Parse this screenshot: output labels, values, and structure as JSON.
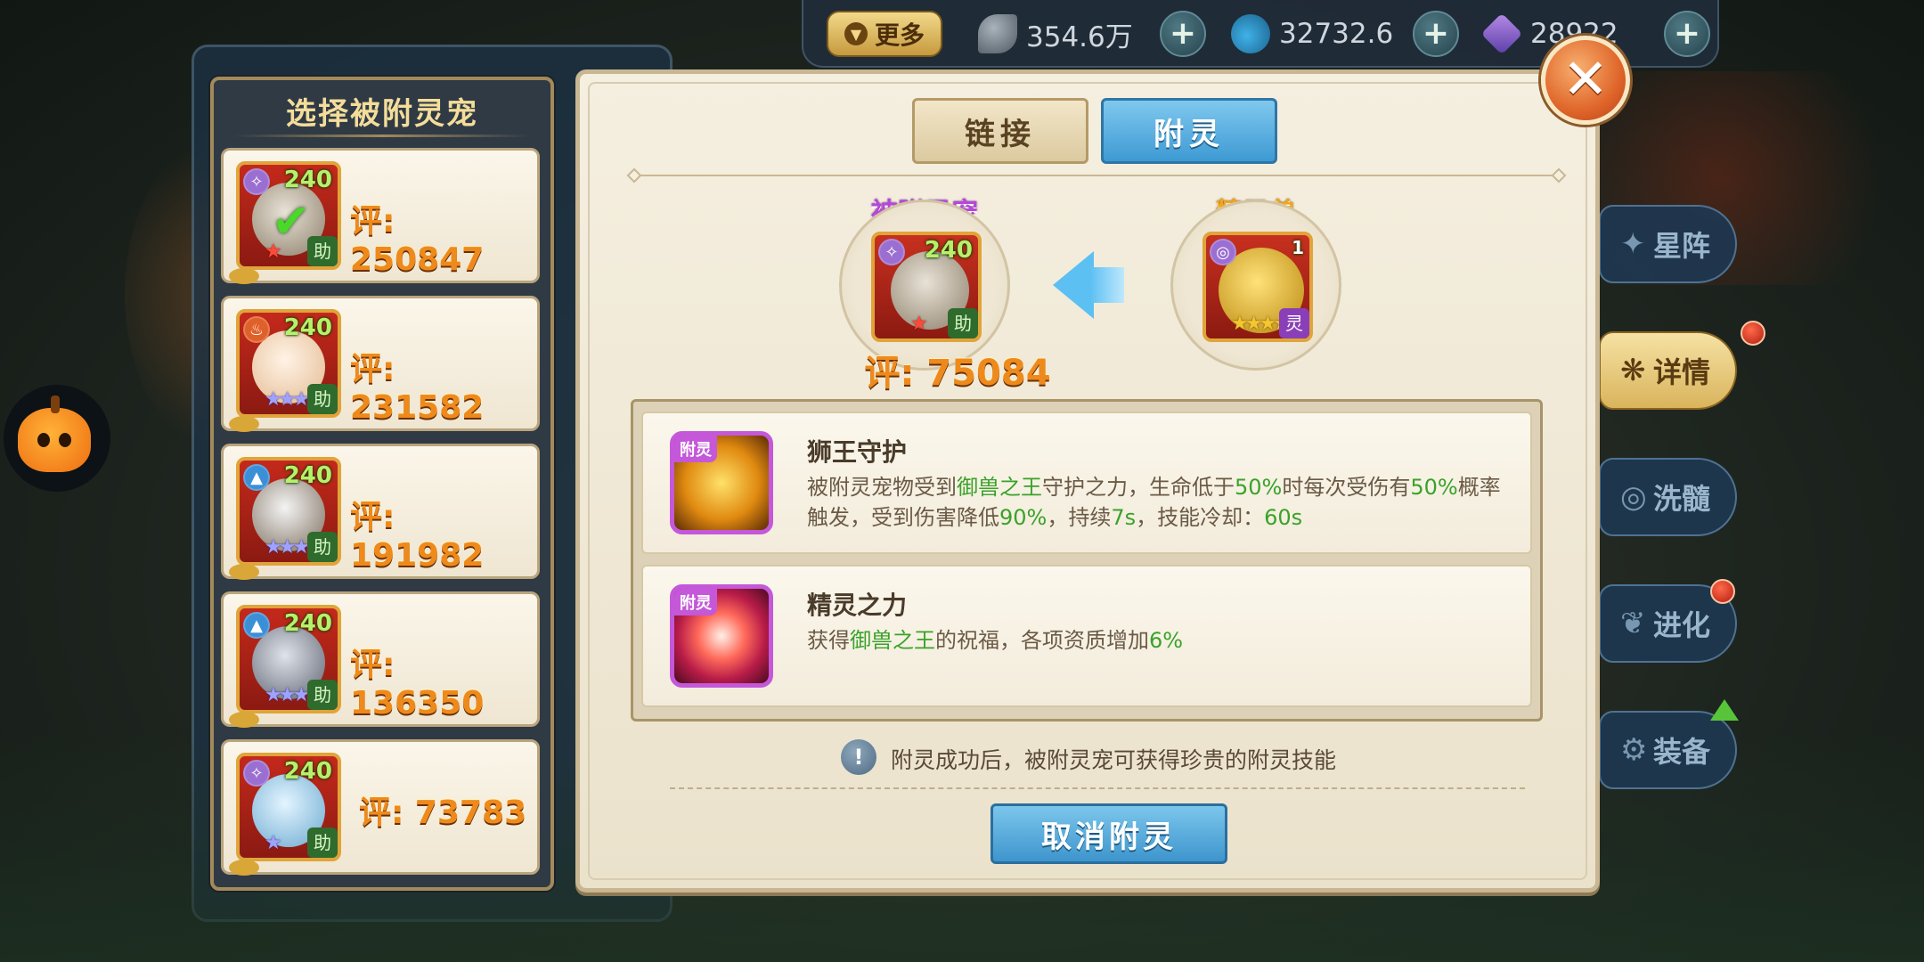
{
  "topbar": {
    "more_label": "更多",
    "resources": [
      {
        "icon": "feather-icon",
        "value": "354.6万"
      },
      {
        "icon": "potion-icon",
        "value": "32732.6"
      },
      {
        "icon": "crystal-icon",
        "value": "28922"
      }
    ],
    "plus_label": "+"
  },
  "side_menu": [
    {
      "label": "星阵",
      "icon": "star-array-icon"
    },
    {
      "label": "详情",
      "icon": "paw-icon",
      "active": true,
      "badge": true
    },
    {
      "label": "洗髓",
      "icon": "refine-icon"
    },
    {
      "label": "进化",
      "icon": "evolve-icon",
      "badge": true
    },
    {
      "label": "装备",
      "icon": "equipment-icon",
      "upgrade_arrow": true
    }
  ],
  "pet_list": {
    "title": "选择被附灵宠",
    "items": [
      {
        "level": "240",
        "score": "评: 250847",
        "assist": "助",
        "element": "✧",
        "elem_color": "#9a6fd1",
        "stars": "★",
        "star_style": "red",
        "selected": true,
        "check": "✔"
      },
      {
        "level": "240",
        "score": "评: 231582",
        "assist": "助",
        "element": "♨",
        "elem_color": "#e0602a",
        "stars": "★★★",
        "star_style": "purple"
      },
      {
        "level": "240",
        "score": "评: 191982",
        "assist": "助",
        "element": "▲",
        "elem_color": "#3b8fd6",
        "stars": "★★★",
        "star_style": "purple"
      },
      {
        "level": "240",
        "score": "评: 136350",
        "assist": "助",
        "element": "▲",
        "elem_color": "#3b8fd6",
        "stars": "★★★",
        "star_style": "purple"
      },
      {
        "level": "240",
        "score": "评: 73783",
        "assist": "助",
        "element": "✧",
        "elem_color": "#9a6fd1",
        "stars": "★",
        "star_style": "purple"
      }
    ]
  },
  "dialog": {
    "tabs": [
      {
        "label": "链接",
        "active": false
      },
      {
        "label": "附灵",
        "active": true
      }
    ],
    "target_slot": {
      "label": "被附灵宠",
      "level": "240",
      "assist": "助",
      "score": "评: 75084"
    },
    "spirit_slot": {
      "label": "精灵兽",
      "badge": "灵",
      "count": "1"
    },
    "skills": [
      {
        "tag": "附灵",
        "name": "狮王守护",
        "desc_parts": [
          {
            "t": "被附灵宠物受到",
            "hl": false
          },
          {
            "t": "御兽之王",
            "hl": true
          },
          {
            "t": "守护之力，生命低于",
            "hl": false
          },
          {
            "t": "50%",
            "hl": true
          },
          {
            "t": "时每次受伤有",
            "hl": false
          },
          {
            "t": "50%",
            "hl": true
          },
          {
            "t": "概率触发，受到伤害降低",
            "hl": false
          },
          {
            "t": "90%",
            "hl": true
          },
          {
            "t": "，持续",
            "hl": false
          },
          {
            "t": "7s",
            "hl": true
          },
          {
            "t": "，技能冷却：",
            "hl": false
          },
          {
            "t": "60s",
            "hl": true
          }
        ]
      },
      {
        "tag": "附灵",
        "name": "精灵之力",
        "desc_parts": [
          {
            "t": "获得",
            "hl": false
          },
          {
            "t": "御兽之王",
            "hl": true
          },
          {
            "t": "的祝福，各项资质增加",
            "hl": false
          },
          {
            "t": "6%",
            "hl": true
          }
        ]
      }
    ],
    "tip_icon": "!",
    "tip": "附灵成功后，被附灵宠可获得珍贵的附灵技能",
    "cancel_label": "取消附灵",
    "close_label": "✕"
  }
}
